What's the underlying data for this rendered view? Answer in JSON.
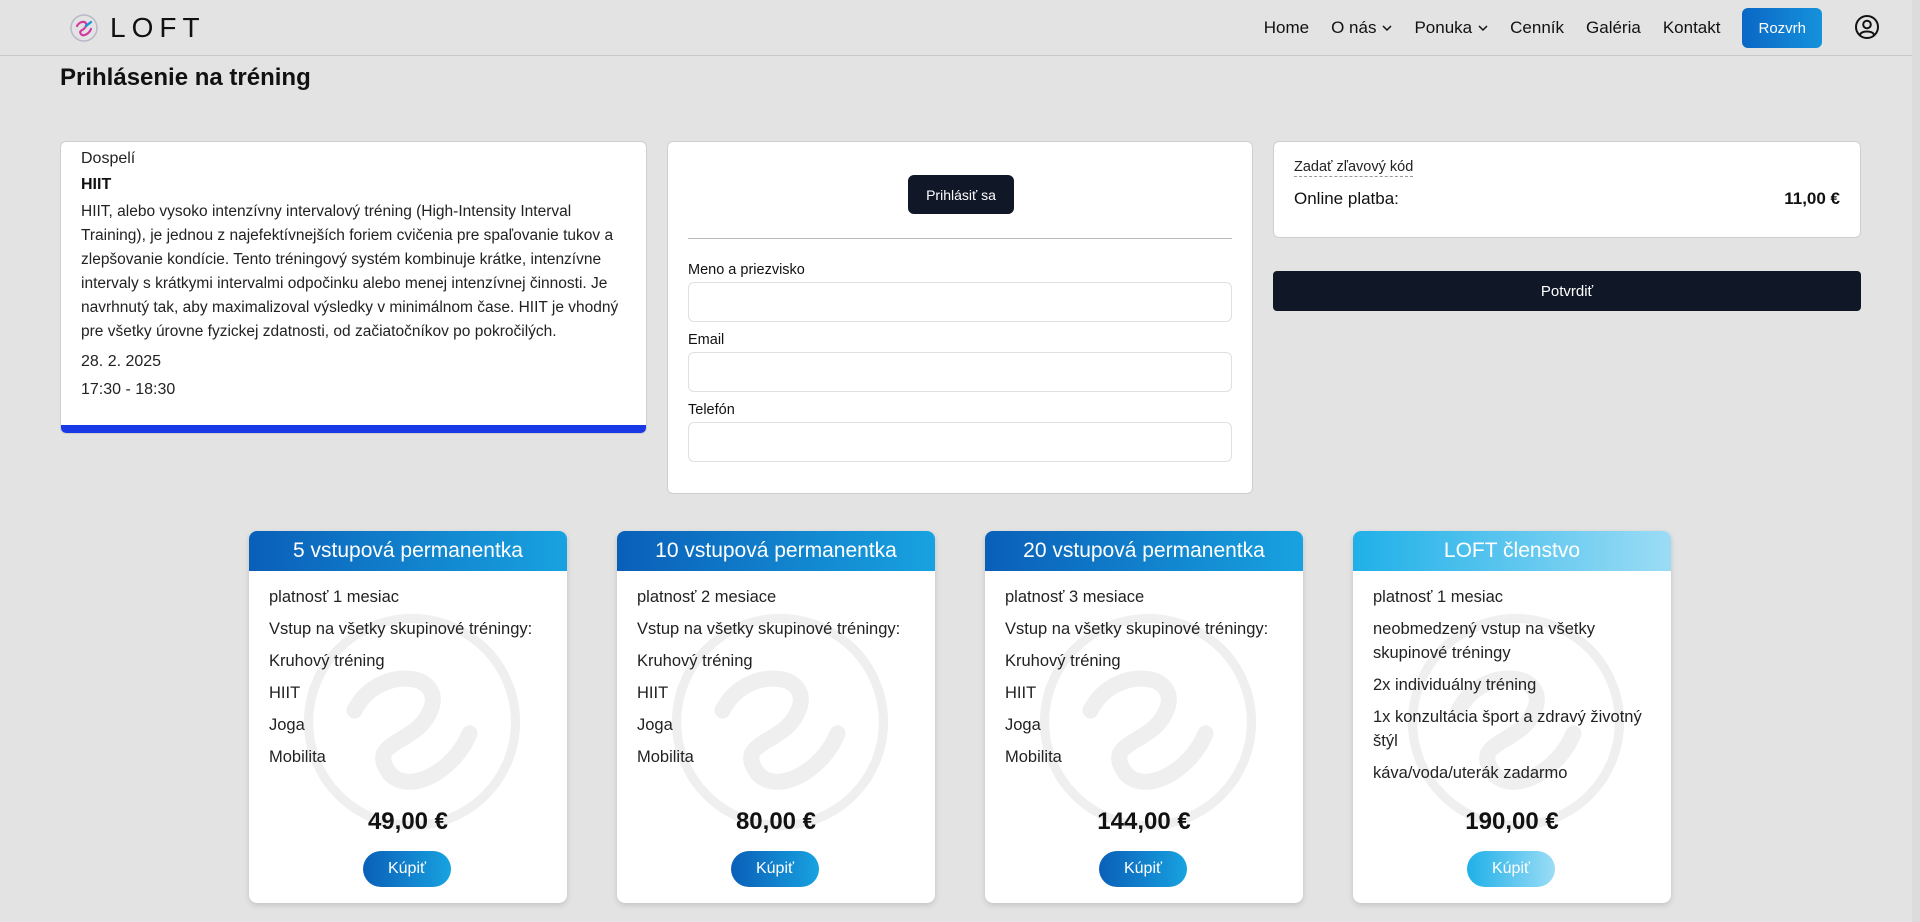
{
  "header": {
    "logo_text": "LOFT",
    "nav": [
      {
        "label": "Home"
      },
      {
        "label": "O nás",
        "dropdown": true
      },
      {
        "label": "Ponuka",
        "dropdown": true
      },
      {
        "label": "Cenník"
      },
      {
        "label": "Galéria"
      },
      {
        "label": "Kontakt"
      }
    ],
    "schedule_button": "Rozvrh"
  },
  "page": {
    "title": "Prihlásenie na tréning"
  },
  "training": {
    "category": "Dospelí",
    "name": "HIIT",
    "description": "HIIT, alebo vysoko intenzívny intervalový tréning (High-Intensity Interval Training), je jednou z najefektívnejších foriem cvičenia pre spaľovanie tukov a zlepšovanie kondície. Tento tréningový systém kombinuje krátke, intenzívne intervaly s krátkymi intervalmi odpočinku alebo menej intenzívnej činnosti. Je navrhnutý tak, aby maximalizoval výsledky v minimálnom čase. HIIT je vhodný pre všetky úrovne fyzickej zdatnosti, od začiatočníkov po pokročilých.",
    "date": "28. 2. 2025",
    "time": "17:30 - 18:30",
    "accent_color": "#1a39e6"
  },
  "form": {
    "login_button": "Prihlásiť sa",
    "name_label": "Meno a priezvisko",
    "name_value": "",
    "email_label": "Email",
    "email_value": "",
    "phone_label": "Telefón",
    "phone_value": ""
  },
  "payment": {
    "discount_link": "Zadať zľavový kód",
    "online_label": "Online platba:",
    "online_value": "11,00 €",
    "confirm_button": "Potvrdiť"
  },
  "plans": [
    {
      "title": "5 vstupová permanentka",
      "features": [
        "platnosť 1 mesiac",
        "Vstup na všetky skupinové tréningy:",
        "Kruhový tréning",
        "HIIT",
        "Joga",
        "Mobilita"
      ],
      "price": "49,00 €",
      "buy": "Kúpiť"
    },
    {
      "title": "10 vstupová permanentka",
      "features": [
        "platnosť 2 mesiace",
        "Vstup na všetky skupinové tréningy:",
        "Kruhový tréning",
        "HIIT",
        "Joga",
        "Mobilita"
      ],
      "price": "80,00 €",
      "buy": "Kúpiť"
    },
    {
      "title": "20 vstupová permanentka",
      "features": [
        "platnosť 3 mesiace",
        "Vstup na všetky skupinové tréningy:",
        "Kruhový tréning",
        "HIIT",
        "Joga",
        "Mobilita"
      ],
      "price": "144,00 €",
      "buy": "Kúpiť"
    },
    {
      "title": "LOFT členstvo",
      "features": [
        "platnosť 1 mesiac",
        "neobmedzený vstup na všetky skupinové tréningy",
        "2x individuálny tréning",
        "1x konzultácia šport a zdravý životný štýl",
        "káva/voda/uterák zadarmo"
      ],
      "price": "190,00 €",
      "buy": "Kúpiť"
    }
  ],
  "colors": {
    "primary_blue": "#0a67c6",
    "dark_button": "#101828",
    "light_blue": "#1fb0e8",
    "background": "#e3e3e3"
  }
}
